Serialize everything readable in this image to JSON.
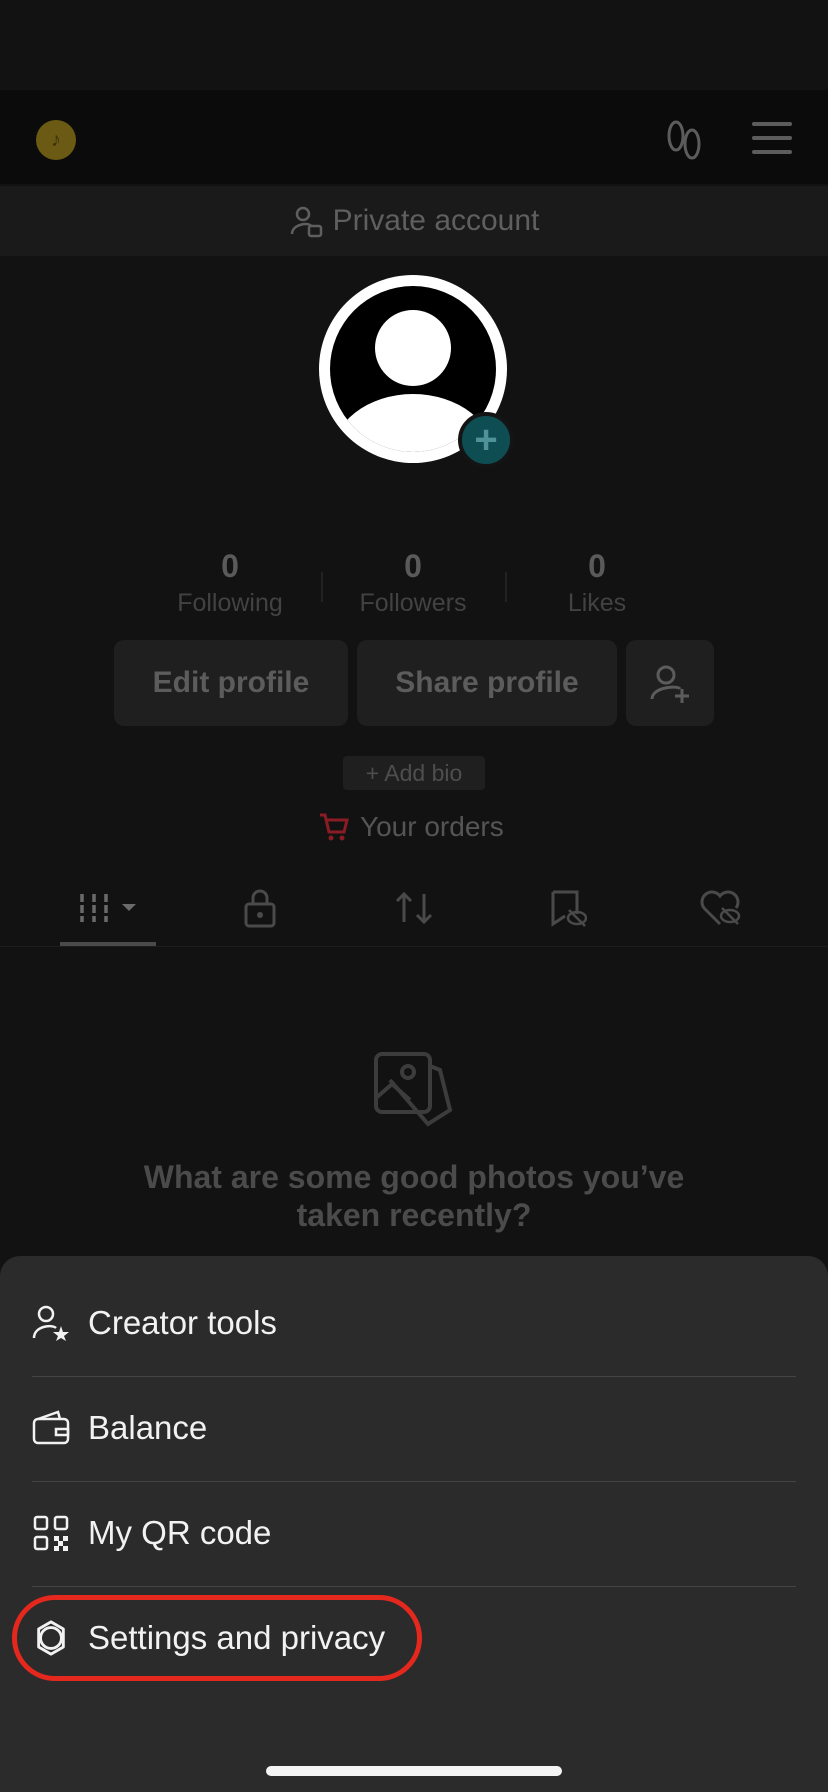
{
  "profile": {
    "private_label": "Private account",
    "stats": [
      {
        "value": "0",
        "label": "Following"
      },
      {
        "value": "0",
        "label": "Followers"
      },
      {
        "value": "0",
        "label": "Likes"
      }
    ],
    "edit_profile": "Edit profile",
    "share_profile": "Share profile",
    "add_bio": "+ Add bio",
    "orders": "Your orders",
    "empty_text": "What are some good photos you’ve taken recently?"
  },
  "sheet": {
    "items": [
      {
        "label": "Creator tools",
        "icon": "person-star-icon"
      },
      {
        "label": "Balance",
        "icon": "wallet-icon"
      },
      {
        "label": "My QR code",
        "icon": "qr-code-icon"
      },
      {
        "label": "Settings and privacy",
        "icon": "gear-icon"
      }
    ]
  },
  "colors": {
    "highlight": "#e5281d",
    "sheet_bg": "#2b2b2b",
    "cart": "#8a1c26"
  }
}
